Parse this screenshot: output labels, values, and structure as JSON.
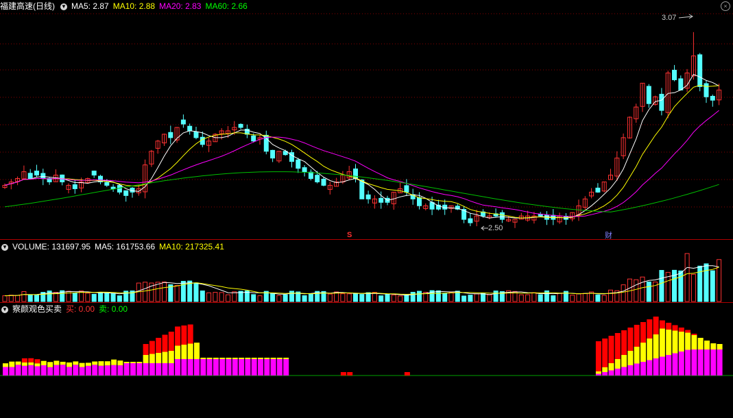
{
  "price_header": {
    "stock_name": "福建高速(日线)",
    "ma5": "MA5: 2.87",
    "ma10": "MA10: 2.88",
    "ma20": "MA20: 2.83",
    "ma60": "MA60: 2.66"
  },
  "volume_header": {
    "volume": "VOLUME: 131697.95",
    "ma5": "MA5: 161753.66",
    "ma10": "MA10: 217325.41"
  },
  "indicator_header": {
    "name": "察颜观色买卖",
    "buy": "买: 0.00",
    "sell": "卖: 0.00"
  },
  "annotations": {
    "high_label": "3.07",
    "low_label": "2.50",
    "marker_s": "S",
    "marker_cai": "财"
  },
  "colors": {
    "up": "#ff3232",
    "down": "#54ffff",
    "ma5": "#ffffff",
    "ma10": "#ffff00",
    "ma20": "#ff00ff",
    "ma60": "#00c000",
    "grid": "#8b0000",
    "yellow_bar": "#ffff00",
    "magenta_bar": "#ff00ff"
  },
  "chart_data": {
    "type": "candlestick",
    "closes": [
      2.62,
      2.63,
      2.64,
      2.66,
      2.64,
      2.65,
      2.64,
      2.63,
      2.65,
      2.63,
      2.62,
      2.61,
      2.63,
      2.64,
      2.65,
      2.63,
      2.62,
      2.61,
      2.6,
      2.59,
      2.6,
      2.61,
      2.68,
      2.72,
      2.75,
      2.77,
      2.76,
      2.79,
      2.8,
      2.78,
      2.76,
      2.74,
      2.75,
      2.77,
      2.78,
      2.78,
      2.79,
      2.79,
      2.77,
      2.75,
      2.76,
      2.72,
      2.7,
      2.72,
      2.71,
      2.69,
      2.67,
      2.66,
      2.64,
      2.63,
      2.62,
      2.62,
      2.63,
      2.65,
      2.66,
      2.64,
      2.58,
      2.58,
      2.58,
      2.57,
      2.57,
      2.6,
      2.61,
      2.6,
      2.58,
      2.56,
      2.56,
      2.55,
      2.55,
      2.55,
      2.56,
      2.55,
      2.52,
      2.51,
      2.53,
      2.53,
      2.53,
      2.53,
      2.52,
      2.52,
      2.52,
      2.53,
      2.53,
      2.53,
      2.53,
      2.52,
      2.52,
      2.53,
      2.52,
      2.54,
      2.56,
      2.58,
      2.6,
      2.6,
      2.63,
      2.65,
      2.7,
      2.76,
      2.82,
      2.85,
      2.92,
      2.86,
      2.88,
      2.84,
      2.95,
      2.93,
      2.9,
      2.95,
      3.0,
      2.91,
      2.88,
      2.87,
      2.9
    ],
    "ylim": [
      2.48,
      3.12
    ]
  }
}
